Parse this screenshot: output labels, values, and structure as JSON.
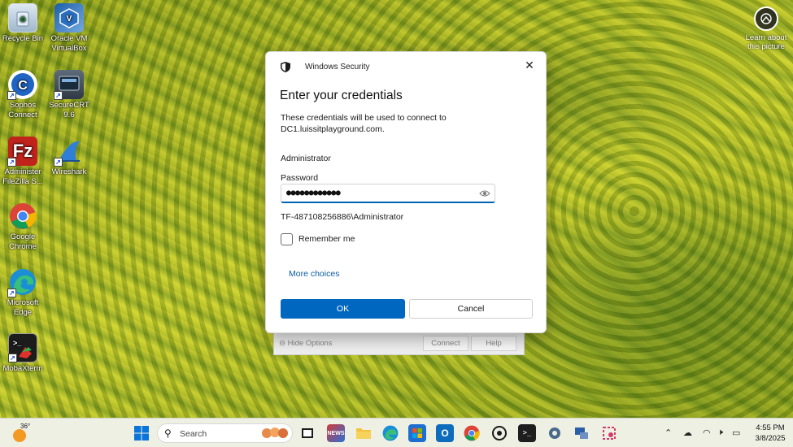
{
  "desktop": {
    "icons": [
      {
        "label": "Recycle Bin",
        "icon": "recycle-bin-icon"
      },
      {
        "label": "Oracle VM VirtualBox",
        "icon": "virtualbox-icon"
      },
      {
        "label": "Sophos Connect",
        "icon": "sophos-connect-icon"
      },
      {
        "label": "SecureCRT 9.6",
        "icon": "securecrt-icon"
      },
      {
        "label": "Administer FileZilla S...",
        "icon": "filezilla-icon"
      },
      {
        "label": "Wireshark",
        "icon": "wireshark-icon"
      },
      {
        "label": "Google Chrome",
        "icon": "chrome-icon"
      },
      {
        "label": "Microsoft Edge",
        "icon": "edge-icon"
      },
      {
        "label": "MobaXterm",
        "icon": "mobaxterm-icon"
      }
    ],
    "learn_about": "Learn about this picture"
  },
  "background_window": {
    "hide_options": "Hide Options",
    "connect": "Connect",
    "help": "Help"
  },
  "dialog": {
    "title": "Windows Security",
    "heading": "Enter your credentials",
    "description": "These credentials will be used to connect to DC1.luissitplayground.com.",
    "username": "Administrator",
    "password_label": "Password",
    "password_value": "●●●●●●●●●●●●",
    "domain_user": "TF-487108256886\\Administrator",
    "remember_me": "Remember me",
    "remember_checked": false,
    "more_choices": "More choices",
    "ok": "OK",
    "cancel": "Cancel",
    "accent_color": "#0067c0"
  },
  "taskbar": {
    "weather_temp": "36°",
    "search_placeholder": "Search",
    "time": "4:55 PM",
    "date": "3/8/2025",
    "pinned": [
      "start-icon",
      "file-explorer-icon",
      "news-icon",
      "folder-icon",
      "edge-icon",
      "store-icon",
      "outlook-icon",
      "chrome-icon",
      "sophos-icon",
      "terminal-icon",
      "settings-icon",
      "network-tool-icon",
      "snip-tool-icon"
    ]
  }
}
